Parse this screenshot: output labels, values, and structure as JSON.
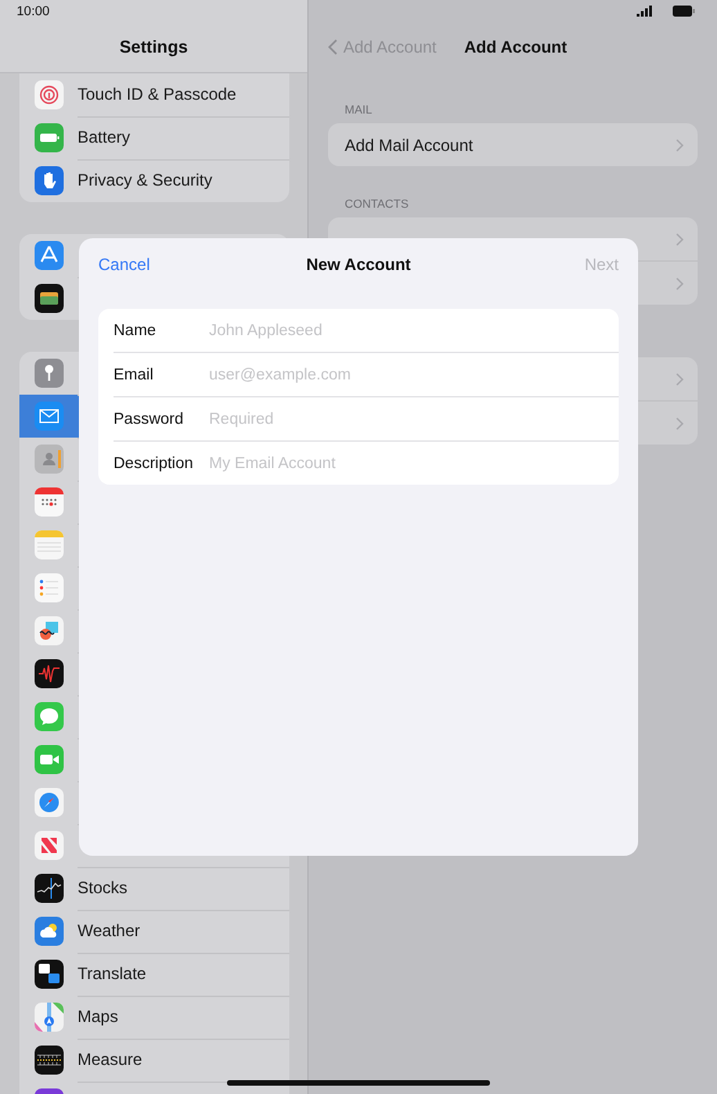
{
  "status_bar": {
    "time": "10:00"
  },
  "sidebar": {
    "title": "Settings",
    "groups": [
      {
        "items": [
          {
            "label": "Touch ID & Passcode",
            "selected": false
          },
          {
            "label": "Battery",
            "selected": false
          },
          {
            "label": "Privacy & Security",
            "selected": false
          }
        ]
      },
      {
        "items": [
          {
            "selected": false
          },
          {
            "selected": false
          }
        ]
      },
      {
        "items": [
          {
            "selected": false
          },
          {
            "selected": true
          },
          {
            "selected": false
          },
          {
            "selected": false
          },
          {
            "selected": false
          },
          {
            "selected": false
          },
          {
            "selected": false
          },
          {
            "selected": false
          },
          {
            "selected": false
          },
          {
            "selected": false
          },
          {
            "selected": false
          },
          {
            "selected": false
          },
          {
            "label": "Stocks",
            "selected": false
          },
          {
            "label": "Weather",
            "selected": false
          },
          {
            "label": "Translate",
            "selected": false
          },
          {
            "label": "Maps",
            "selected": false
          },
          {
            "label": "Measure",
            "selected": false
          },
          {
            "selected": false
          }
        ]
      }
    ]
  },
  "detail": {
    "back": "Add Account",
    "title": "Add Account",
    "sections": [
      {
        "header": "MAIL",
        "rows": [
          {
            "kind": "link",
            "label": "Add Mail Account"
          }
        ]
      },
      {
        "header": "CONTACTS",
        "rows": [
          {
            "kind": "link"
          },
          {
            "kind": "link"
          }
        ]
      },
      {
        "rows": [
          {
            "kind": "link"
          },
          {
            "kind": "link"
          }
        ]
      }
    ]
  },
  "dialog": {
    "cancel": "Cancel",
    "title": "New Account",
    "next": {
      "label": "Next",
      "disabled": true
    },
    "fields": [
      {
        "label": "Name",
        "placeholder": "John Appleseed"
      },
      {
        "label": "Email",
        "placeholder": "user@example.com"
      },
      {
        "label": "Password",
        "placeholder": "Required"
      },
      {
        "label": "Description",
        "placeholder": "My Email Account"
      }
    ]
  }
}
